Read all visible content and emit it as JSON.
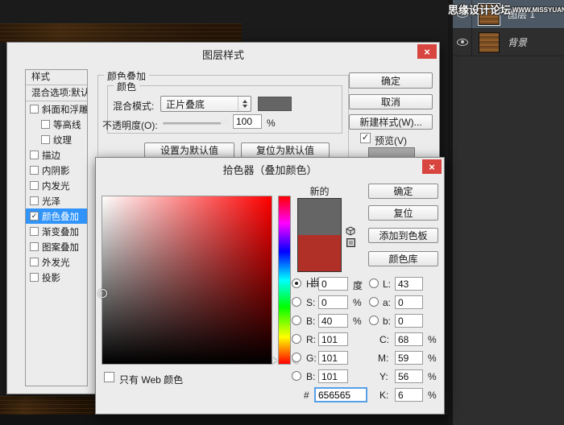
{
  "icons": {
    "close": "×",
    "check": "✓"
  },
  "watermark": {
    "site_name": "思缘设计论坛",
    "site_url": "WWW.MISSYUAN.COM"
  },
  "layers_panel": {
    "layer1_name": "图层 1",
    "background_name": "背景"
  },
  "layer_style": {
    "title": "图层样式",
    "sidebar": {
      "header": "样式",
      "blending_options": "混合选项:默认",
      "items": [
        {
          "label": "斜面和浮雕"
        },
        {
          "label": "等高线"
        },
        {
          "label": "纹理"
        },
        {
          "label": "描边"
        },
        {
          "label": "内阴影"
        },
        {
          "label": "内发光"
        },
        {
          "label": "光泽"
        },
        {
          "label": "颜色叠加"
        },
        {
          "label": "渐变叠加"
        },
        {
          "label": "图案叠加"
        },
        {
          "label": "外发光"
        },
        {
          "label": "投影"
        }
      ]
    },
    "group_title": "颜色叠加",
    "color_group_title": "颜色",
    "blend_mode_label": "混合模式:",
    "blend_mode_value": "正片叠底",
    "blend_swatch_color": "#656565",
    "opacity_label": "不透明度(O):",
    "opacity_value": "100",
    "opacity_unit": "%",
    "set_default": "设置为默认值",
    "reset_default": "复位为默认值",
    "ok": "确定",
    "cancel": "取消",
    "new_style": "新建样式(W)...",
    "preview": "预览(V)"
  },
  "color_picker": {
    "title": "拾色器（叠加颜色）",
    "new_label": "新的",
    "current_label": "当前",
    "new_color": "#656565",
    "current_color": "#b03028",
    "ok": "确定",
    "reset": "复位",
    "add_to_swatches": "添加到色板",
    "color_library": "颜色库",
    "rows_left": [
      {
        "label": "H:",
        "value": "0",
        "unit": "度"
      },
      {
        "label": "S:",
        "value": "0",
        "unit": "%"
      },
      {
        "label": "B:",
        "value": "40",
        "unit": "%"
      },
      {
        "label": "R:",
        "value": "101",
        "unit": ""
      },
      {
        "label": "G:",
        "value": "101",
        "unit": ""
      },
      {
        "label": "B:",
        "value": "101",
        "unit": ""
      }
    ],
    "rows_right": [
      {
        "label": "L:",
        "value": "43",
        "unit": ""
      },
      {
        "label": "a:",
        "value": "0",
        "unit": ""
      },
      {
        "label": "b:",
        "value": "0",
        "unit": ""
      },
      {
        "label": "C:",
        "value": "68",
        "unit": "%"
      },
      {
        "label": "M:",
        "value": "59",
        "unit": "%"
      },
      {
        "label": "Y:",
        "value": "56",
        "unit": "%"
      },
      {
        "label": "K:",
        "value": "6",
        "unit": "%"
      }
    ],
    "hex_label": "#",
    "hex_value": "656565",
    "web_only": "只有 Web 颜色"
  },
  "colors": {
    "selection_blue": "#3094fb",
    "close_red": "#d8453e",
    "panel_bg": "#2e2e2e"
  }
}
